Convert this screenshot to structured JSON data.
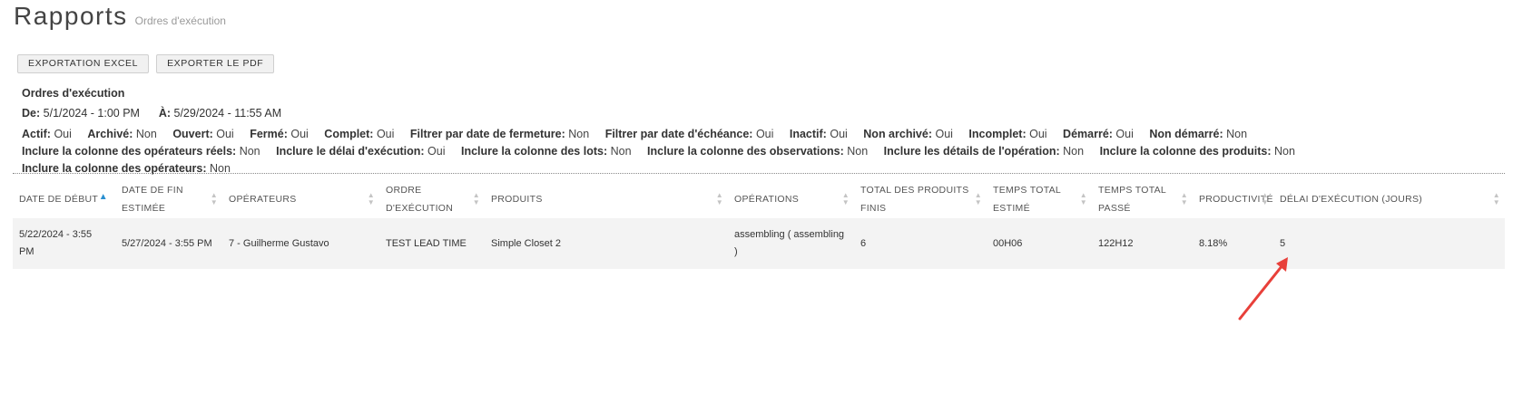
{
  "page": {
    "title": "Rapports",
    "subtitle": "Ordres d'exécution"
  },
  "toolbar": {
    "excel_label": "EXPORTATION EXCEL",
    "pdf_label": "EXPORTER LE PDF"
  },
  "report": {
    "name": "Ordres d'exécution",
    "from_label": "De:",
    "from_value": "5/1/2024 - 1:00 PM",
    "to_label": "À:",
    "to_value": "5/29/2024 - 11:55 AM"
  },
  "filters": [
    {
      "label": "Actif:",
      "value": "Oui"
    },
    {
      "label": "Archivé:",
      "value": "Non"
    },
    {
      "label": "Ouvert:",
      "value": "Oui"
    },
    {
      "label": "Fermé:",
      "value": "Oui"
    },
    {
      "label": "Complet:",
      "value": "Oui"
    },
    {
      "label": "Filtrer par date de fermeture:",
      "value": "Non"
    },
    {
      "label": "Filtrer par date d'échéance:",
      "value": "Oui"
    },
    {
      "label": "Inactif:",
      "value": "Oui"
    },
    {
      "label": "Non archivé:",
      "value": "Oui"
    },
    {
      "label": "Incomplet:",
      "value": "Oui"
    },
    {
      "label": "Démarré:",
      "value": "Oui"
    },
    {
      "label": "Non démarré:",
      "value": "Non"
    },
    {
      "label": "Inclure la colonne des opérateurs réels:",
      "value": "Non"
    },
    {
      "label": "Inclure le délai d'exécution:",
      "value": "Oui"
    },
    {
      "label": "Inclure la colonne des lots:",
      "value": "Non"
    },
    {
      "label": "Inclure la colonne des observations:",
      "value": "Non"
    },
    {
      "label": "Inclure les détails de l'opération:",
      "value": "Non"
    },
    {
      "label": "Inclure la colonne des produits:",
      "value": "Non"
    },
    {
      "label": "Inclure la colonne des opérateurs:",
      "value": "Non"
    }
  ],
  "table": {
    "columns": [
      "DATE DE DÉBUT",
      "DATE DE FIN ESTIMÉE",
      "OPÉRATEURS",
      "ORDRE D'EXÉCUTION",
      "PRODUITS",
      "OPÉRATIONS",
      "TOTAL DES PRODUITS FINIS",
      "TEMPS TOTAL ESTIMÉ",
      "TEMPS TOTAL PASSÉ",
      "PRODUCTIVITÉ",
      "DÉLAI D'EXÉCUTION (JOURS)"
    ],
    "rows": [
      [
        "5/22/2024 - 3:55 PM",
        "5/27/2024 - 3:55 PM",
        "7 - Guilherme Gustavo",
        "TEST LEAD TIME",
        "Simple Closet 2",
        "assembling ( assembling )",
        "6",
        "00H06",
        "122H12",
        "8.18%",
        "5"
      ]
    ]
  },
  "colors": {
    "annotation_arrow": "#e8403a",
    "sort_active": "#2a8fd0",
    "row_bg": "#f3f3f3"
  }
}
